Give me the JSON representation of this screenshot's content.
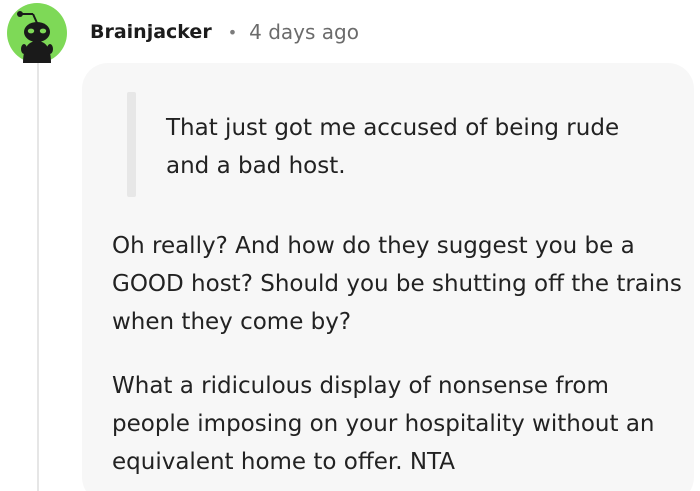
{
  "comment": {
    "username": "Brainjacker",
    "separator": "•",
    "timestamp": "4 days ago",
    "avatar_icon": "reddit-snoo-avatar-icon",
    "avatar_color": "#7ed957",
    "quote": "That just got me accused of being rude and a bad host.",
    "paragraphs": [
      "Oh really? And how do they suggest you be a GOOD host? Should you be shutting off the trains when they come by?",
      "What a ridiculous display of nonsense from people imposing on your hospitality without an equivalent home to offer. NTA"
    ]
  }
}
